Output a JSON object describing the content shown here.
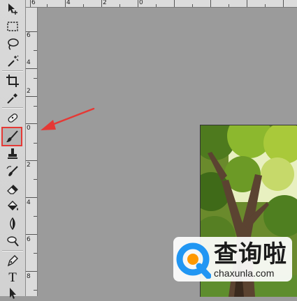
{
  "toolbar": {
    "tools": [
      {
        "icon": "move-icon"
      },
      {
        "icon": "marquee-icon"
      },
      {
        "icon": "lasso-icon"
      },
      {
        "icon": "magic-wand-icon"
      },
      {
        "icon": "crop-icon"
      },
      {
        "icon": "eyedropper-icon"
      },
      {
        "icon": "healing-brush-icon"
      },
      {
        "icon": "brush-icon",
        "active": true
      },
      {
        "icon": "clone-stamp-icon"
      },
      {
        "icon": "history-brush-icon"
      },
      {
        "icon": "eraser-icon"
      },
      {
        "icon": "paint-bucket-icon"
      },
      {
        "icon": "blur-icon"
      },
      {
        "icon": "dodge-icon"
      },
      {
        "icon": "pen-icon"
      },
      {
        "icon": "type-icon",
        "label": "T"
      },
      {
        "icon": "path-selection-icon"
      }
    ],
    "highlight_color": "#e53935"
  },
  "ruler": {
    "top_labels": [
      "6",
      "4",
      "2",
      "0"
    ],
    "left_labels": [
      "6",
      "4",
      "2",
      "0",
      "2",
      "4",
      "6",
      "8"
    ]
  },
  "annotation": {
    "arrow_color": "#e53935"
  },
  "watermark": {
    "title": "查询啦",
    "subtitle": "chaxunla.com",
    "logo_color": "#2196f3",
    "logo_accent": "#ff9800"
  },
  "colors": {
    "workspace": "#9b9b9b",
    "toolbar": "#d5d5d5"
  }
}
